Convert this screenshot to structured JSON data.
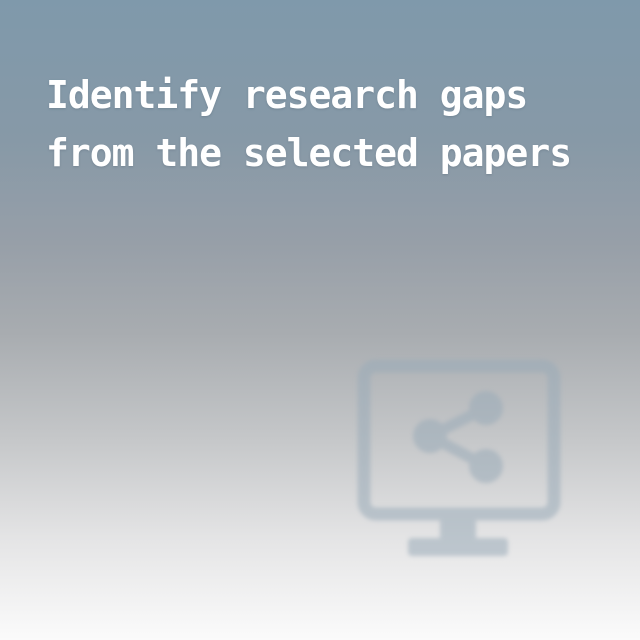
{
  "card": {
    "title": "Identify research gaps from the selected papers",
    "icon": "monitor-share-icon"
  },
  "colors": {
    "background_top": "#7f99ab",
    "background_bottom": "#fbfbfb",
    "title_text": "#ffffff",
    "icon": "#9aabb8"
  }
}
